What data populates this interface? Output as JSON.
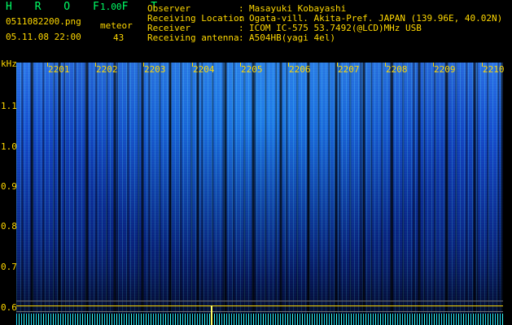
{
  "header": {
    "app_name": "H R O F F T",
    "app_version": "1.00",
    "file_name": "0511082200.png",
    "date_time": "05.11.08 22:00",
    "meteor_label": "meteor",
    "meteor_count": "43"
  },
  "info": {
    "observer_label": "Observer",
    "observer_value": "Masayuki Kobayashi",
    "location_label": "Receiving Location",
    "location_value": "Ogata-vill. Akita-Pref. JAPAN (139.96E, 40.02N)",
    "receiver_label": "Receiver",
    "receiver_value": "ICOM IC-575 53.7492(@LCD)MHz USB",
    "antenna_label": "Receiving antenna",
    "antenna_value": "A504HB(yagi 4el)"
  },
  "axes": {
    "y_unit": "kHz",
    "y_ticks": [
      "1.1",
      "1.0",
      "0.9",
      "0.8",
      "0.7",
      "0.6"
    ],
    "minute_labels": [
      "2201",
      "2202",
      "2203",
      "2204",
      "2205",
      "2206",
      "2207",
      "2208",
      "2209",
      "2210"
    ]
  },
  "colors": {
    "label_yellow": "#ffd800",
    "title_green": "#00ff66",
    "spectrogram_blue": "#1346c8",
    "signal_cyan": "#37ffff"
  }
}
